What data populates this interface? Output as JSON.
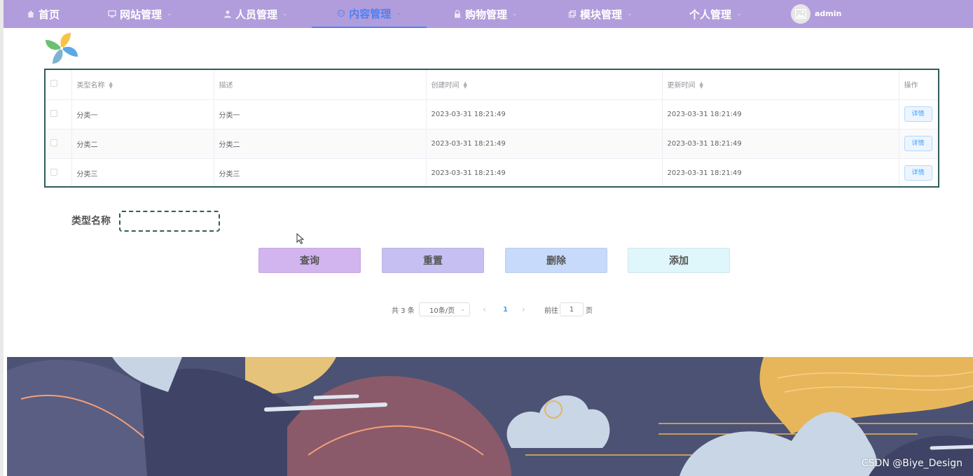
{
  "nav": {
    "items": [
      {
        "label": "首页",
        "icon": "home-icon"
      },
      {
        "label": "网站管理",
        "icon": "monitor-icon"
      },
      {
        "label": "人员管理",
        "icon": "user-icon"
      },
      {
        "label": "内容管理",
        "icon": "chat-icon",
        "active": true
      },
      {
        "label": "购物管理",
        "icon": "lock-icon"
      },
      {
        "label": "模块管理",
        "icon": "copy-icon"
      },
      {
        "label": "个人管理",
        "icon": ""
      }
    ],
    "username": "admin"
  },
  "table": {
    "headers": {
      "name": "类型名称",
      "desc": "描述",
      "created": "创建时间",
      "updated": "更新时间",
      "ops": "操作"
    },
    "detail_label": "详情",
    "rows": [
      {
        "name": "分类一",
        "desc": "分类一",
        "created": "2023-03-31 18:21:49",
        "updated": "2023-03-31 18:21:49"
      },
      {
        "name": "分类二",
        "desc": "分类二",
        "created": "2023-03-31 18:21:49",
        "updated": "2023-03-31 18:21:49"
      },
      {
        "name": "分类三",
        "desc": "分类三",
        "created": "2023-03-31 18:21:49",
        "updated": "2023-03-31 18:21:49"
      }
    ]
  },
  "search": {
    "label": "类型名称",
    "value": ""
  },
  "buttons": {
    "query": "查询",
    "reset": "重置",
    "delete": "删除",
    "add": "添加"
  },
  "pagination": {
    "total": "共 3 条",
    "page_size": "10条/页",
    "current": "1",
    "goto": "前往",
    "jump_value": "1",
    "page_unit": "页"
  },
  "watermark": "CSDN @Biye_Design",
  "colors": {
    "nav_bg": "#b19cdc",
    "active": "#4d82f0",
    "query": "#d2b4ee",
    "reset": "#c6c0f2",
    "delete": "#c8dafb",
    "add": "#dff6fb"
  }
}
